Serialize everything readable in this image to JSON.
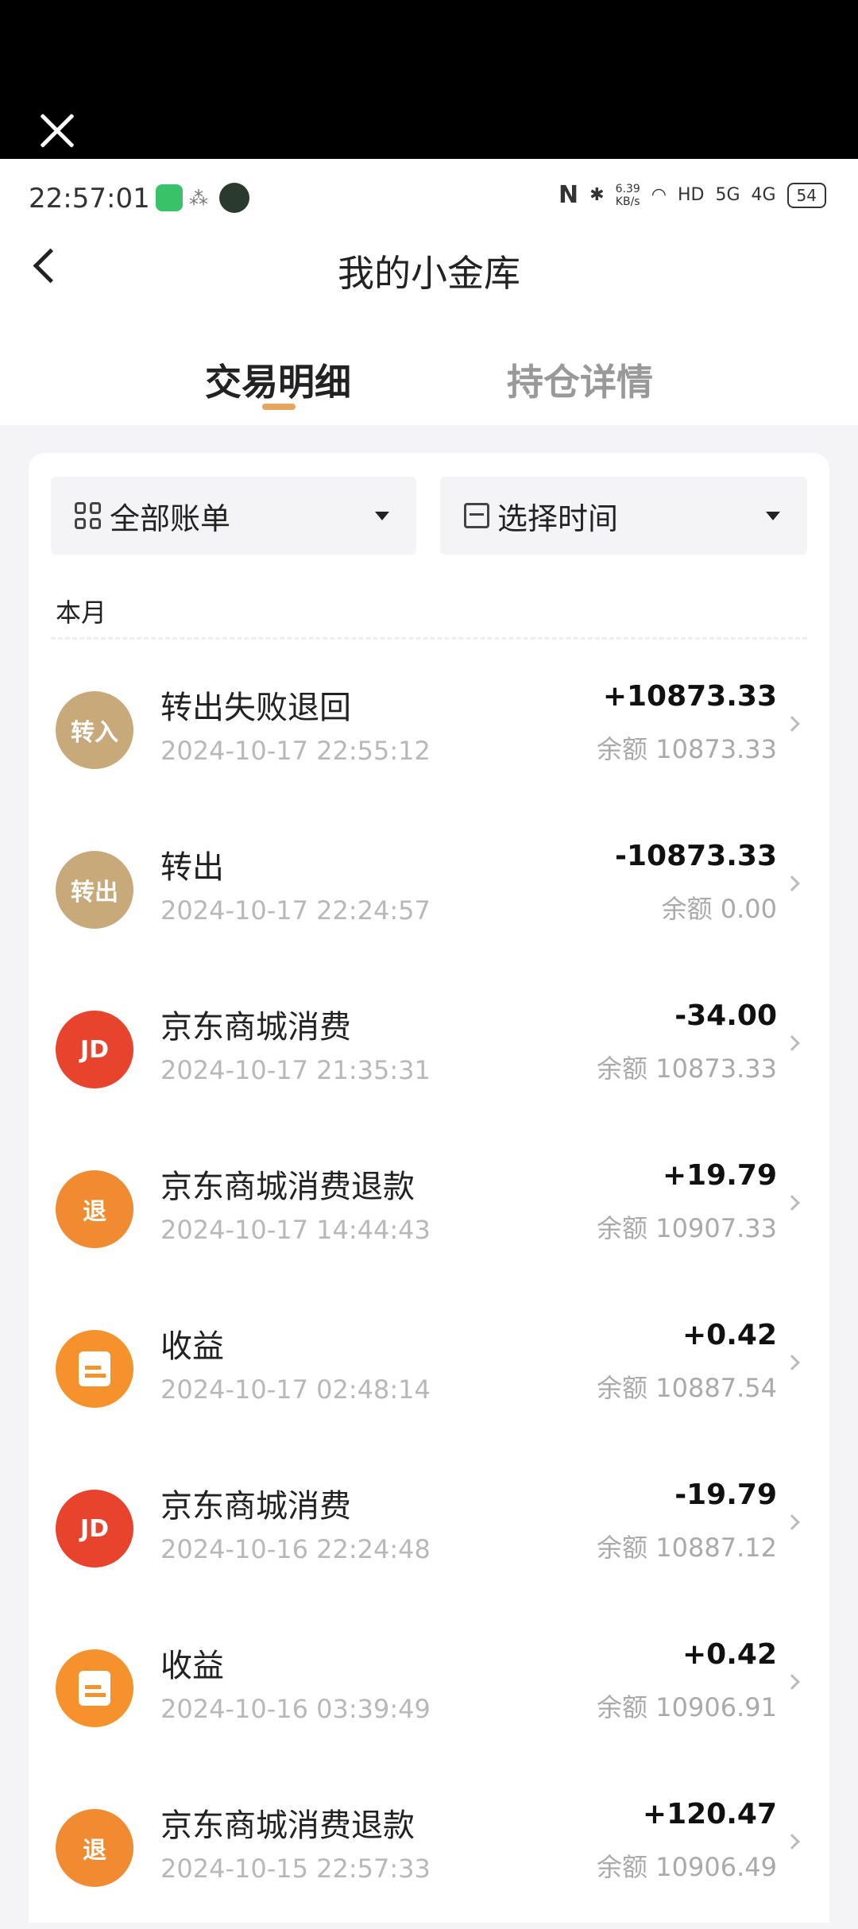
{
  "overlay": {
    "close_icon": "close-icon"
  },
  "status_bar": {
    "time": "22:57:01",
    "net_speed_value": "6.39",
    "net_speed_unit": "KB/s",
    "wifi_label": "HD",
    "signal1": "5G",
    "signal2": "4G",
    "battery": "54"
  },
  "nav": {
    "title": "我的小金库"
  },
  "tabs": [
    {
      "label": "交易明细",
      "active": true
    },
    {
      "label": "持仓详情",
      "active": false
    }
  ],
  "filters": {
    "bill_type": "全部账单",
    "time": "选择时间"
  },
  "section_label": "本月",
  "transactions": [
    {
      "icon_text": "转入",
      "title": "转出失败退回",
      "time": "2024-10-17 22:55:12",
      "amount": "+10873.33",
      "balance": "余额 10873.33"
    },
    {
      "icon_text": "转出",
      "title": "转出",
      "time": "2024-10-17 22:24:57",
      "amount": "-10873.33",
      "balance": "余额 0.00"
    },
    {
      "icon_text": "JD",
      "title": "京东商城消费",
      "time": "2024-10-17 21:35:31",
      "amount": "-34.00",
      "balance": "余额 10873.33"
    },
    {
      "icon_text": "退",
      "title": "京东商城消费退款",
      "time": "2024-10-17 14:44:43",
      "amount": "+19.79",
      "balance": "余额 10907.33"
    },
    {
      "icon_text": "",
      "title": "收益",
      "time": "2024-10-17 02:48:14",
      "amount": "+0.42",
      "balance": "余额 10887.54"
    },
    {
      "icon_text": "JD",
      "title": "京东商城消费",
      "time": "2024-10-16 22:24:48",
      "amount": "-19.79",
      "balance": "余额 10887.12"
    },
    {
      "icon_text": "",
      "title": "收益",
      "time": "2024-10-16 03:39:49",
      "amount": "+0.42",
      "balance": "余额 10906.91"
    },
    {
      "icon_text": "退",
      "title": "京东商城消费退款",
      "time": "2024-10-15 22:57:33",
      "amount": "+120.47",
      "balance": "余额 10906.49"
    }
  ],
  "colors": {
    "accent": "#e5a65e",
    "gold_icon": "#c7a97a",
    "jd_red": "#e8432d",
    "orange": "#f08b32"
  }
}
